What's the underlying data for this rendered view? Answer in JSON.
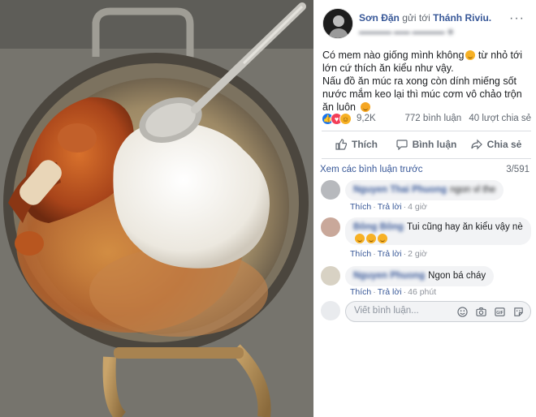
{
  "post": {
    "author": "Sơn Đặn",
    "sent_to_text": "gửi tới",
    "target_page": "Thánh Riviu.",
    "more_label": "···",
    "text_line1": "Có mem nào giống mình không",
    "text_line1b": " từ nhỏ tới lớn cứ thích ăn kiểu như vậy.",
    "text_line2": "Nấu đồ ăn múc ra xong còn dính miếng sốt nước mắm keo lại thì múc cơm vô chảo trộn ăn luôn",
    "reaction_count": "9,2K",
    "comments_count": "772 bình luận",
    "shares_count": "40 lượt chia sẻ"
  },
  "actions": {
    "like": "Thích",
    "comment": "Bình luận",
    "share": "Chia sẻ"
  },
  "comments_section": {
    "view_previous": "Xem các bình luận trước",
    "count": "3/591"
  },
  "comments": [
    {
      "text": "ngon vl the",
      "like": "Thích",
      "reply": "Trả lời",
      "time": "4 giờ"
    },
    {
      "text": "Tui cũng hay ăn kiểu vậy nè",
      "like": "Thích",
      "reply": "Trả lời",
      "time": "2 giờ"
    },
    {
      "text": "Ngon bá cháy",
      "like": "Thích",
      "reply": "Trả lời",
      "time": "46 phút"
    }
  ],
  "composer": {
    "placeholder": "Viết bình luận..."
  },
  "colors": {
    "link": "#385898",
    "like_blue": "#1877f2",
    "love_red": "#f33e58",
    "haha_yellow": "#f7b125"
  },
  "icons": [
    "like-icon",
    "love-icon",
    "haha-icon",
    "thumb-icon",
    "comment-icon",
    "share-icon",
    "emoji-icon",
    "camera-icon",
    "gif-icon",
    "sticker-icon"
  ]
}
